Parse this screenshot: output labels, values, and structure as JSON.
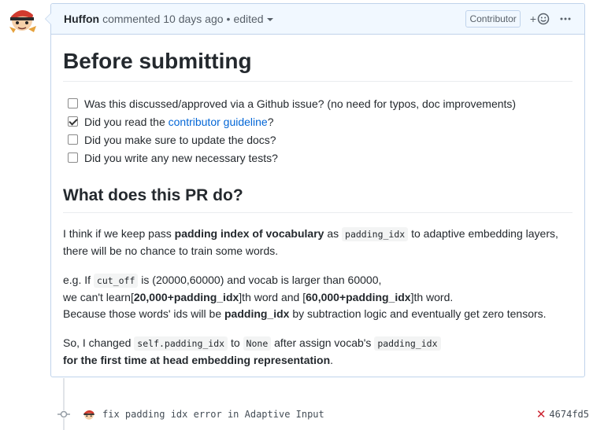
{
  "comment": {
    "author": "Huffon",
    "action": "commented",
    "time": "10 days ago",
    "separator": "•",
    "edited": "edited",
    "badge": "Contributor",
    "react_plus": "+",
    "heading": "Before submitting",
    "tasks": [
      {
        "text": "Was this discussed/approved via a Github issue? (no need for typos, doc improvements)",
        "checked": false
      },
      {
        "pre": "Did you read the ",
        "link": "contributor guideline",
        "post": "?",
        "checked": true
      },
      {
        "text": "Did you make sure to update the docs?",
        "checked": false
      },
      {
        "text": "Did you write any new necessary tests?",
        "checked": false
      }
    ],
    "subheading": "What does this PR do?",
    "p1": {
      "a": "I think if we keep pass ",
      "b": "padding index of vocabulary",
      "c": " as ",
      "code": "padding_idx",
      "d": " to adaptive embedding layers, there will be no chance to train some words."
    },
    "p2": {
      "a": "e.g. If ",
      "code": "cut_off",
      "b": " is (20000,60000) and vocab is larger than 60000,",
      "c": "we can't learn[",
      "d": "20,000+padding_idx",
      "e": "]th word and [",
      "f": "60,000+padding_idx",
      "g": "]th word.",
      "h": "Because those words' ids will be ",
      "i": "padding_idx",
      "j": " by subtraction logic and eventually get zero tensors."
    },
    "p3": {
      "a": "So, I changed ",
      "code1": "self.padding_idx",
      "b": " to ",
      "code2": "None",
      "c": " after assign vocab's ",
      "code3": "padding_idx",
      "d": "for the first time at head embedding representation",
      "e": "."
    }
  },
  "commit": {
    "message": "fix padding idx error in Adaptive Input",
    "status_icon": "x-icon",
    "sha": "4674fd5"
  },
  "colors": {
    "header_bg": "#f1f8ff",
    "border": "#c0d3eb",
    "link": "#0366d6",
    "fail": "#cb2431"
  }
}
